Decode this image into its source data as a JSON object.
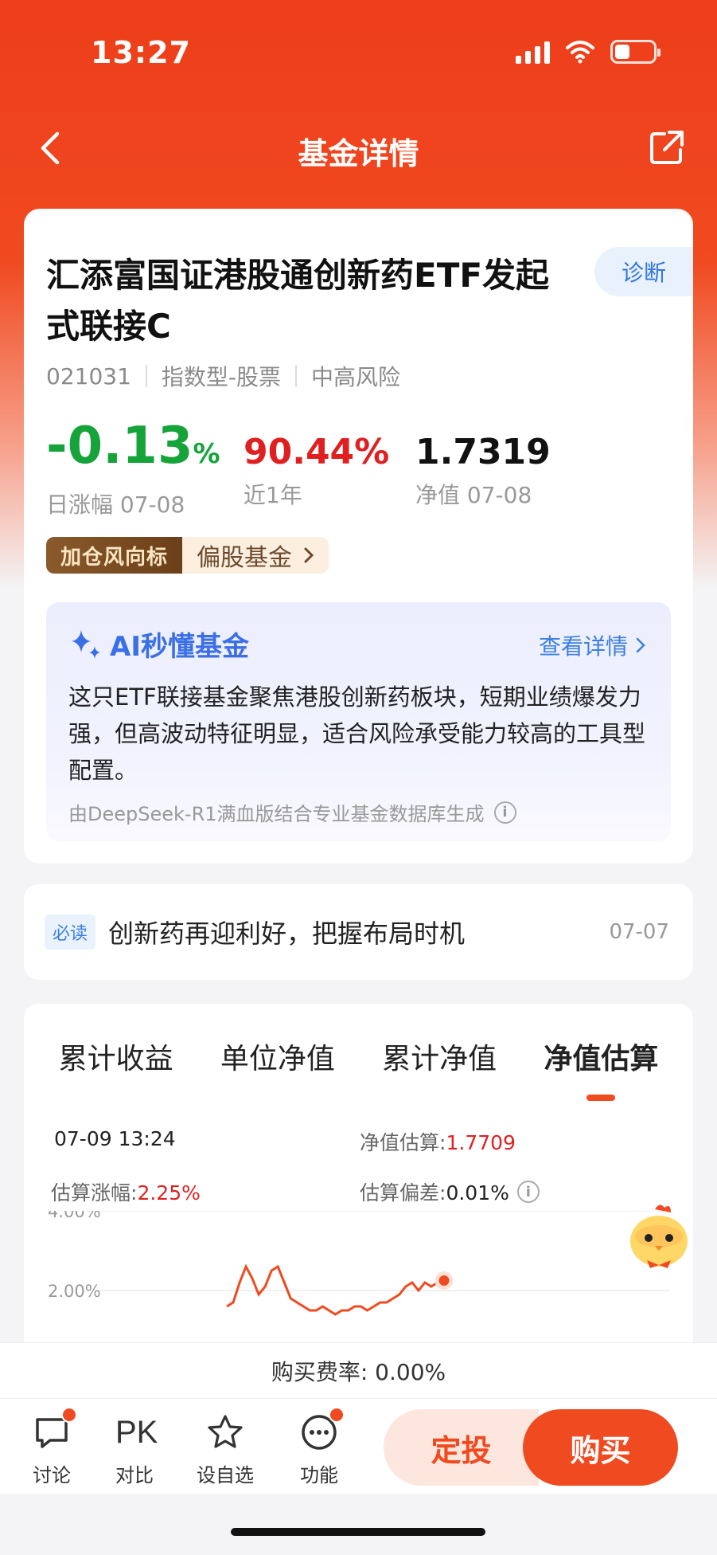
{
  "status_bar": {
    "time": "13:27"
  },
  "nav": {
    "title": "基金详情"
  },
  "fund": {
    "name": "汇添富国证港股通创新药ETF发起式联接C",
    "diagnose": "诊断",
    "code": "021031",
    "type": "指数型-股票",
    "risk": "中高风险",
    "daily_change": "-0.13",
    "daily_change_unit": "%",
    "daily_label": "日涨幅 07-08",
    "year_return": "90.44%",
    "year_label": "近1年",
    "nav_value": "1.7319",
    "nav_label": "净值 07-08",
    "tag_badge": "加仓风向标",
    "tag_category": "偏股基金"
  },
  "ai": {
    "title": "AI秒懂基金",
    "detail_link": "查看详情",
    "summary": "这只ETF联接基金聚焦港股创新药板块，短期业绩爆发力强，但高波动特征明显，适合风险承受能力较高的工具型配置。",
    "footer": "由DeepSeek-R1满血版结合专业基金数据库生成"
  },
  "news": {
    "tag": "必读",
    "title": "创新药再迎利好，把握布局时机",
    "date": "07-07"
  },
  "chart_tabs": [
    "累计收益",
    "单位净值",
    "累计净值",
    "净值估算"
  ],
  "estimate": {
    "time": "07-09 13:24",
    "nav_est_label": "净值估算:",
    "nav_est_value": "1.7709",
    "change_label": "估算涨幅:",
    "change_value": "2.25%",
    "deviation_label": "估算偏差:",
    "deviation_value": "0.01%"
  },
  "chart_data": {
    "type": "line",
    "ytick_labels": [
      "4.00%",
      "2.00%"
    ],
    "series_color": "#f04a20",
    "note": "intraday estimate line partially visible; values in % change",
    "x": [
      0,
      1,
      2,
      3,
      4,
      5,
      6,
      7,
      8,
      9,
      10,
      11,
      12,
      13,
      14,
      15,
      16,
      17,
      18,
      19,
      20,
      21,
      22,
      23,
      24,
      25,
      26,
      27,
      28,
      29,
      30,
      31,
      32,
      33,
      34
    ],
    "values": [
      1.6,
      1.7,
      2.2,
      2.6,
      2.3,
      1.9,
      2.1,
      2.5,
      2.6,
      2.2,
      1.8,
      1.7,
      1.6,
      1.5,
      1.5,
      1.6,
      1.5,
      1.4,
      1.5,
      1.5,
      1.6,
      1.6,
      1.5,
      1.6,
      1.7,
      1.7,
      1.8,
      1.9,
      2.1,
      2.2,
      2.0,
      2.2,
      2.1,
      2.2,
      2.25
    ],
    "ylim": [
      1.4,
      4.2
    ],
    "grid": true
  },
  "fee": {
    "text": "购买费率: 0.00%"
  },
  "bottom": {
    "discuss": "讨论",
    "pk_glyph": "PK",
    "compare": "对比",
    "watch": "设自选",
    "more": "功能",
    "dingtou": "定投",
    "buy": "购买"
  },
  "colors": {
    "brand": "#f04a20",
    "up": "#e02020",
    "down": "#16a33a",
    "link": "#3b7fe0"
  }
}
